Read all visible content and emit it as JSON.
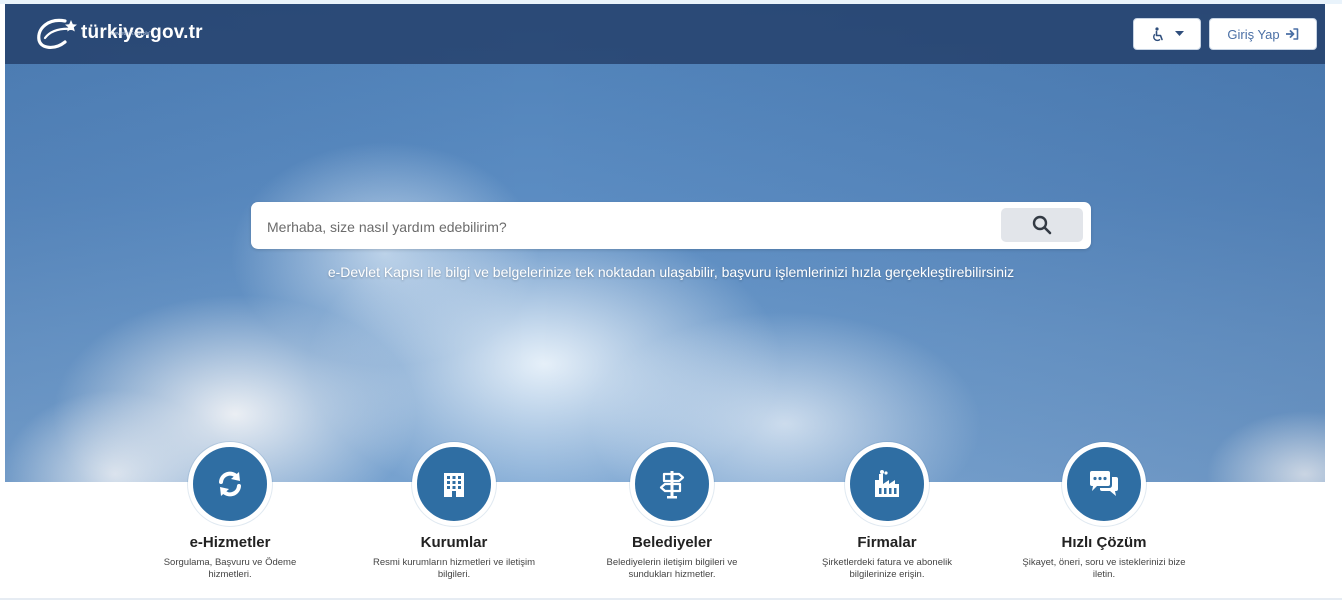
{
  "header": {
    "logo_text": "türkiye.gov.tr",
    "logo_tagline": "\"Devletin Kısayolu\"",
    "accessibility_icon": "wheelchair-icon",
    "login_label": "Giriş Yap"
  },
  "search": {
    "placeholder": "Merhaba, size nasıl yardım edebilirim?",
    "icon": "search-icon"
  },
  "tagline": "e-Devlet Kapısı ile bilgi ve belgelerinize tek noktadan ulaşabilir, başvuru işlemlerinizi hızla gerçekleştirebilirsiniz",
  "cards": [
    {
      "title": "e-Hizmetler",
      "desc": "Sorgulama, Başvuru ve Ödeme hizmetleri.",
      "icon": "refresh-icon"
    },
    {
      "title": "Kurumlar",
      "desc": "Resmi kurumların hizmetleri ve iletişim bilgileri.",
      "icon": "building-icon"
    },
    {
      "title": "Belediyeler",
      "desc": "Belediyelerin iletişim bilgileri ve sundukları hizmetler.",
      "icon": "signpost-icon"
    },
    {
      "title": "Firmalar",
      "desc": "Şirketlerdeki fatura ve abonelik bilgilerinize erişin.",
      "icon": "factory-icon"
    },
    {
      "title": "Hızlı Çözüm",
      "desc": "Şikayet, öneri, soru ve isteklerinizi bize iletin.",
      "icon": "chat-icon"
    }
  ],
  "colors": {
    "navbar": "#233e69",
    "accent": "#2f6ea3",
    "sky": "#5b8cc2"
  }
}
